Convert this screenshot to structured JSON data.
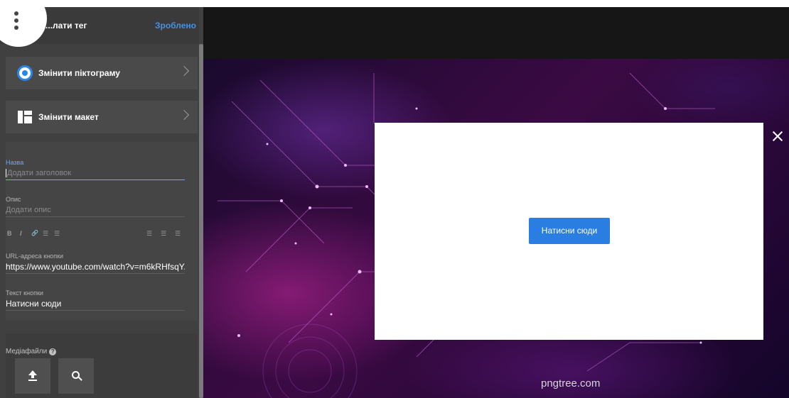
{
  "sidebar": {
    "header": {
      "title": "...лати тег",
      "done_label": "Зроблено"
    },
    "rows": [
      {
        "label": "Змінити піктограму",
        "icon": "radio-icon"
      },
      {
        "label": "Змінити макет",
        "icon": "layout-icon"
      }
    ],
    "form": {
      "title_label": "Назва",
      "title_placeholder": "Додати заголовок",
      "description_label": "Опис",
      "description_placeholder": "Додати опис",
      "toolbar": [
        "B",
        "I",
        "link",
        "ordered-list",
        "bulleted-list",
        "align-left",
        "align-center",
        "align-right"
      ],
      "toolbar_glyphs": [
        "B",
        "I",
        "🔗",
        "☰",
        "☰",
        "☰",
        "☰",
        "☰"
      ],
      "url_label": "URL-адреса кнопки",
      "url_value": "https://www.youtube.com/watch?v=m6kRHfsqY...",
      "button_text_label": "Текст кнопки",
      "button_text_value": "Натисни сюди"
    },
    "media": {
      "label": "Медіафайли",
      "help_icon": "help-icon",
      "buttons": [
        "upload-icon",
        "search-icon"
      ]
    }
  },
  "preview": {
    "button_label": "Натисни сюди",
    "watermark": "pngtree.com",
    "close_icon": "close-icon"
  },
  "colors": {
    "accent": "#2a7de1",
    "link": "#4a90e2",
    "sidebar_bg": "#404040"
  }
}
